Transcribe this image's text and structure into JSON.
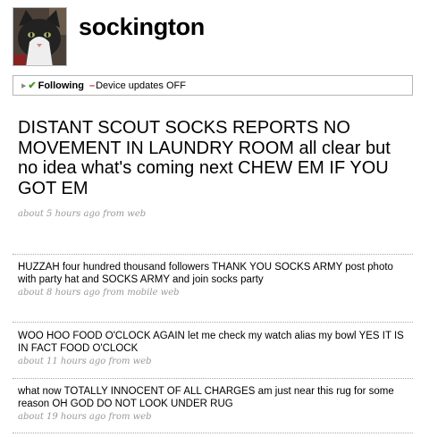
{
  "profile": {
    "username": "sockington",
    "avatar_icon": "cat-avatar"
  },
  "status_bar": {
    "following_label": "Following",
    "device_updates_label": "Device updates OFF"
  },
  "latest_tweet": {
    "text": "DISTANT SCOUT SOCKS REPORTS NO MOVEMENT IN LAUNDRY ROOM all clear but no idea what's coming next CHEW EM IF YOU GOT EM",
    "meta": "about 5 hours ago from web"
  },
  "timeline": [
    {
      "text": "HUZZAH four hundred thousand followers THANK YOU SOCKS ARMY post photo with party hat and SOCKS ARMY and join socks party",
      "meta": "about 8 hours ago from mobile web"
    },
    {
      "text": "WOO HOO FOOD O'CLOCK AGAIN let me check my watch alias my bowl YES IT IS IN FACT FOOD O'CLOCK",
      "meta": "about 11 hours ago from web"
    },
    {
      "text": "what now TOTALLY INNOCENT OF ALL CHARGES am just near this rug for some reason OH GOD DO NOT LOOK UNDER RUG",
      "meta": "about 19 hours ago from web"
    }
  ]
}
